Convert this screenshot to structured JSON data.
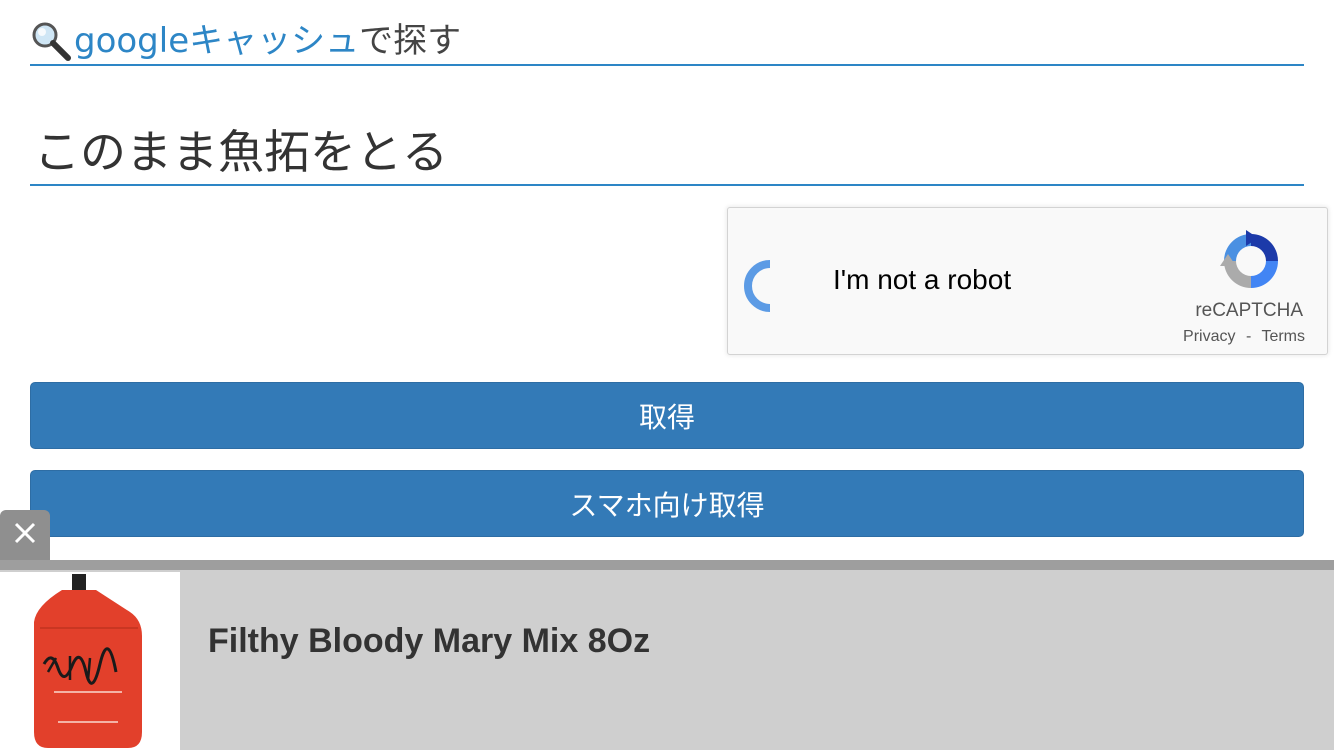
{
  "cache_section": {
    "icon": "magnifier-icon",
    "link_text": "googleキャッシュ",
    "suffix": "で探す",
    "link_color": "#2d86c6"
  },
  "gyotaku_section": {
    "heading": "このまま魚拓をとる"
  },
  "recaptcha": {
    "checkbox_label": "I'm not a robot",
    "brand": "reCAPTCHA",
    "privacy_link": "Privacy",
    "separator": "-",
    "terms_link": "Terms",
    "state": "loading"
  },
  "buttons": {
    "get_label": "取得",
    "mobile_get_label": "スマホ向け取得",
    "color": "#337ab7"
  },
  "ad": {
    "close_icon": "close-icon",
    "product_title": "Filthy Bloody Mary Mix 8Oz",
    "product_image": "red-pouch-product-image"
  }
}
